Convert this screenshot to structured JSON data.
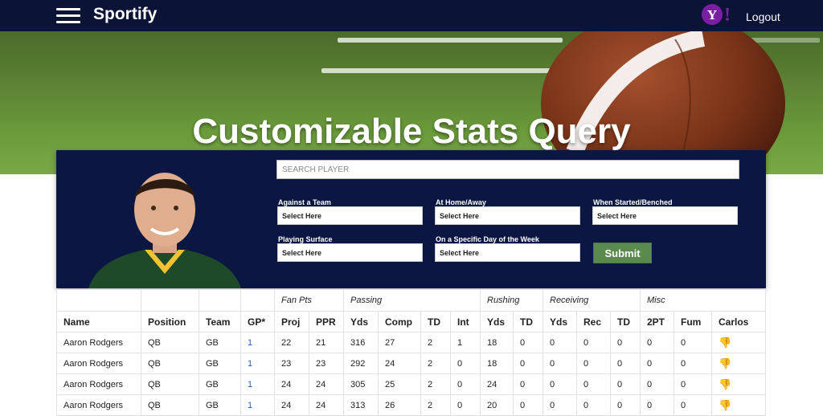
{
  "app": {
    "brand": "Sportify",
    "logout_label": "Logout",
    "yahoo_logo": "Y!"
  },
  "hero": {
    "title": "Customizable Stats Query"
  },
  "search": {
    "placeholder": "SEARCH PLAYER"
  },
  "filters": [
    {
      "label": "Against a Team",
      "value": "Select Here"
    },
    {
      "label": "At Home/Away",
      "value": "Select Here"
    },
    {
      "label": "When Started/Benched",
      "value": "Select Here"
    },
    {
      "label": "Playing Surface",
      "value": "Select Here"
    },
    {
      "label": "On a Specific Day of the Week",
      "value": "Select Here"
    }
  ],
  "submit_label": "Submit",
  "table": {
    "groups": [
      "Fan Pts",
      "Passing",
      "Rushing",
      "Receiving",
      "Misc"
    ],
    "headers": [
      "Name",
      "Position",
      "Team",
      "GP*",
      "Proj",
      "PPR",
      "Yds",
      "Comp",
      "TD",
      "Int",
      "Yds",
      "TD",
      "Yds",
      "Rec",
      "TD",
      "2PT",
      "Fum",
      "Carlos"
    ],
    "rows": [
      [
        "Aaron Rodgers",
        "QB",
        "GB",
        "1",
        "22",
        "21",
        "316",
        "27",
        "2",
        "1",
        "18",
        "0",
        "0",
        "0",
        "0",
        "0",
        "0"
      ],
      [
        "Aaron Rodgers",
        "QB",
        "GB",
        "1",
        "23",
        "23",
        "292",
        "24",
        "2",
        "0",
        "18",
        "0",
        "0",
        "0",
        "0",
        "0",
        "0"
      ],
      [
        "Aaron Rodgers",
        "QB",
        "GB",
        "1",
        "24",
        "24",
        "305",
        "25",
        "2",
        "0",
        "24",
        "0",
        "0",
        "0",
        "0",
        "0",
        "0"
      ],
      [
        "Aaron Rodgers",
        "QB",
        "GB",
        "1",
        "24",
        "24",
        "313",
        "26",
        "2",
        "0",
        "20",
        "0",
        "0",
        "0",
        "0",
        "0",
        "0"
      ]
    ],
    "carlos_icon": "thumbs-down-icon"
  }
}
